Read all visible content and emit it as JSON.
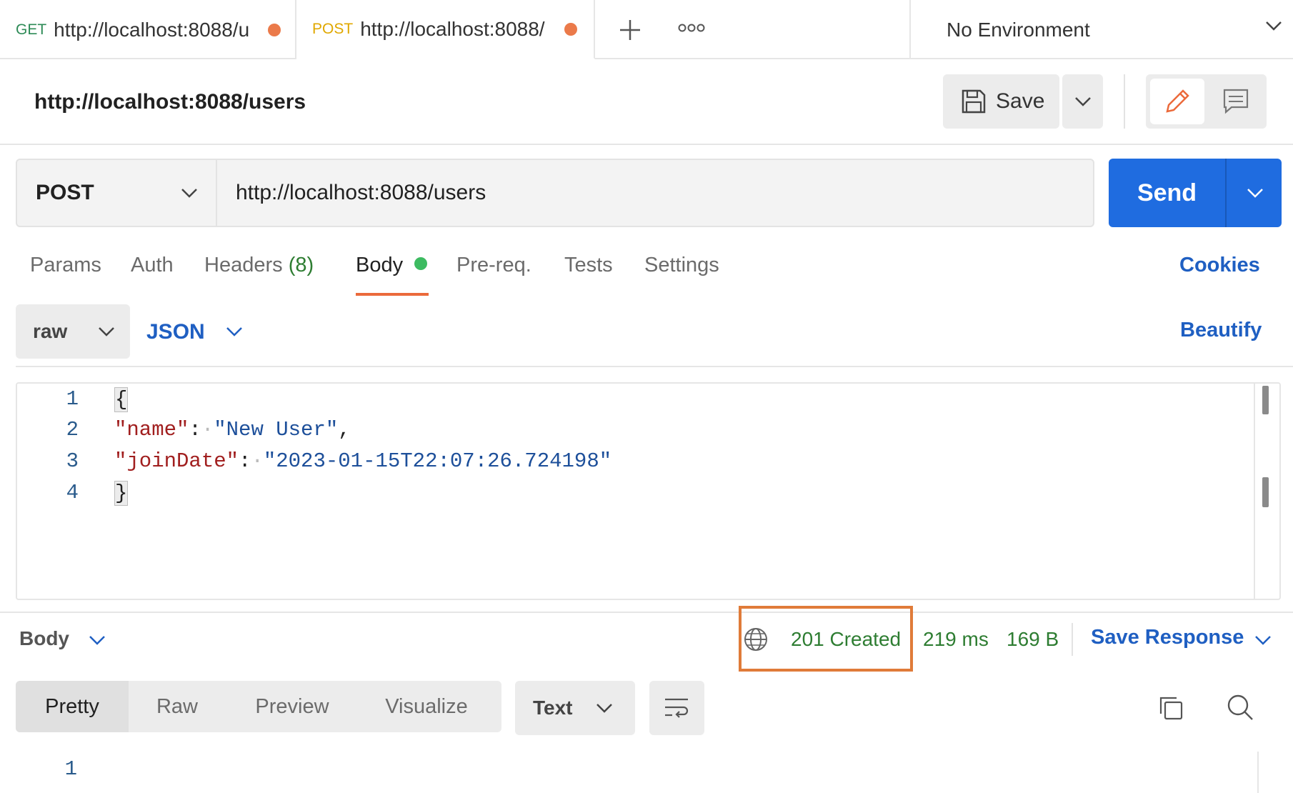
{
  "tabs": [
    {
      "method": "GET",
      "method_color": "#2e8b57",
      "url": "http://localhost:8088/u"
    },
    {
      "method": "POST",
      "method_color": "#e0a800",
      "url": "http://localhost:8088/"
    }
  ],
  "environment": {
    "label": "No Environment"
  },
  "request": {
    "title": "http://localhost:8088/users",
    "save_label": "Save",
    "method": "POST",
    "url": "http://localhost:8088/users",
    "send_label": "Send"
  },
  "request_tabs": {
    "params": "Params",
    "auth": "Auth",
    "headers": "Headers",
    "headers_count": "(8)",
    "body": "Body",
    "prereq": "Pre-req.",
    "tests": "Tests",
    "settings": "Settings",
    "cookies": "Cookies"
  },
  "body_options": {
    "mode": "raw",
    "format": "JSON",
    "beautify": "Beautify"
  },
  "editor": {
    "line_numbers": [
      "1",
      "2",
      "3",
      "4"
    ],
    "open_brace": "{",
    "close_brace": "}",
    "line2_key": "\"name\"",
    "line2_colon": ":",
    "line2_value": "\"New User\"",
    "line2_comma": ",",
    "line3_key": "\"joinDate\"",
    "line3_colon": ":",
    "line3_value": "\"2023-01-15T22:07:26.724198\""
  },
  "response": {
    "section_label": "Body",
    "status": "201 Created",
    "time": "219 ms",
    "size": "169 B",
    "save_response": "Save Response",
    "view_tabs": [
      "Pretty",
      "Raw",
      "Preview",
      "Visualize"
    ],
    "type_label": "Text",
    "line_numbers": [
      "1"
    ]
  },
  "colors": {
    "accent": "#1f6ce0",
    "status_green": "#2e7d32",
    "highlight": "#e07b39",
    "tab_active": "#eb6a3b"
  }
}
